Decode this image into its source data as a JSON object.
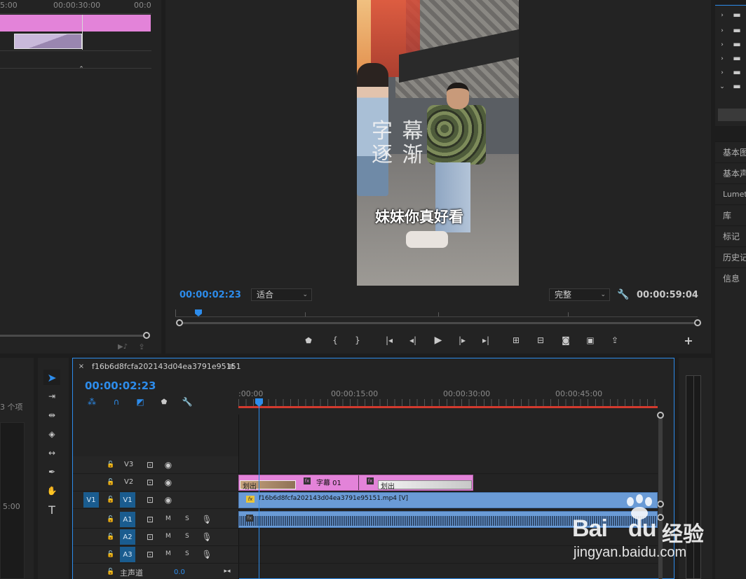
{
  "source_monitor": {
    "ruler_labels": [
      "5:00",
      "00:00:30:00",
      "00:0"
    ]
  },
  "program_monitor": {
    "current_time": "00:00:02:23",
    "zoom_value": "适合",
    "quality_value": "完整",
    "duration": "00:00:59:04",
    "video_overlay_title_line1": "字 幕",
    "video_overlay_title_line2": "逐 渐",
    "video_subtitle": "妹妹你真好看"
  },
  "project_panel": {
    "item_count": "3 个项",
    "timecode_label": "5:00"
  },
  "right_panels": {
    "items": [
      "基本图",
      "基本声",
      "Lumet",
      "库",
      "标记",
      "历史记",
      "信息"
    ]
  },
  "timeline": {
    "sequence_name": "f16b6d8fcfa202143d04ea3791e95151",
    "current_time": "00:00:02:23",
    "ruler_labels": [
      ":00:00",
      "00:00:15:00",
      "00:00:30:00",
      "00:00:45:00"
    ],
    "tracks": {
      "v3": "V3",
      "v2": "V2",
      "v1": "V1",
      "v1_source": "V1",
      "a1": "A1",
      "a2": "A2",
      "a3": "A3",
      "mute": "M",
      "solo": "S",
      "master": "主声道",
      "master_value": "0.0"
    },
    "clips": {
      "v2_transition_out": "划出",
      "v2_title": "字幕 01",
      "v2_transition_out2": "划出",
      "v1_clip": "f16b6d8fcfa202143d04ea3791e95151.mp4 [V]",
      "fx_badge": "fx"
    }
  },
  "watermark": {
    "brand": "Bai",
    "brand2": "du",
    "brand_cn": "经验",
    "url": "jingyan.baidu.com"
  },
  "colors": {
    "accent_blue": "#2d8ceb",
    "clip_pink": "#e383d9",
    "clip_blue": "#6a9bd6",
    "playhead_red": "#d23a2e"
  }
}
